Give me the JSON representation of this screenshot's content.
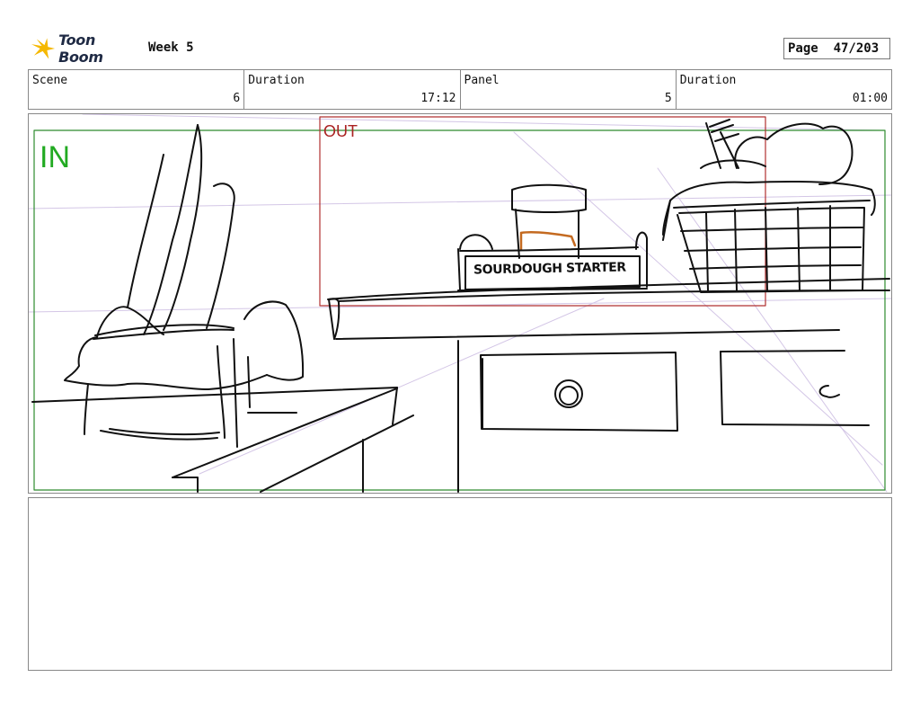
{
  "header": {
    "brand": "Toon Boom",
    "title": "Week 5",
    "page_label": "Page",
    "page_value": "47/203"
  },
  "info": [
    {
      "label": "Scene",
      "value": "6"
    },
    {
      "label": "Duration",
      "value": "17:12"
    },
    {
      "label": "Panel",
      "value": "5"
    },
    {
      "label": "Duration",
      "value": "01:00"
    }
  ],
  "panel": {
    "in_label": "IN",
    "out_label": "OUT",
    "sign_text": "SOURDOUGH STARTER"
  },
  "colors": {
    "in_frame": "#2e8b2e",
    "out_frame": "#b03030",
    "logo_accent": "#f5b800"
  }
}
